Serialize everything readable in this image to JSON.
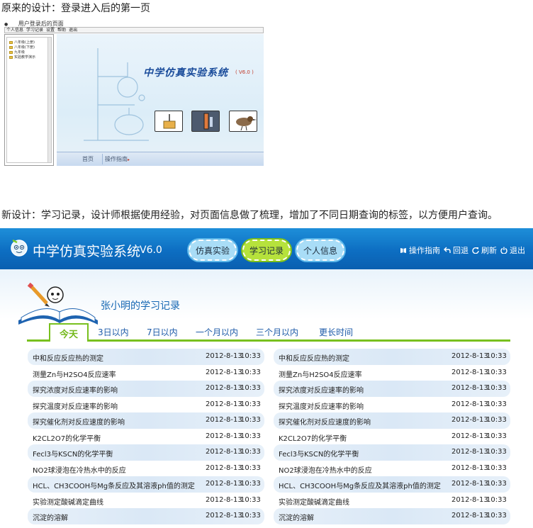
{
  "captions": {
    "old": "原来的设计：登录进入后的第一页",
    "new": "新设计：学习记录，设计师根据使用经验，对页面信息做了梳理，增加了不同日期查询的标签，以方便用户查询。"
  },
  "old_design": {
    "window_title": "用户登录后的页面",
    "menu": [
      "个人信息",
      "学习记录",
      "设置",
      "帮助",
      "退出"
    ],
    "tree_items": [
      "八年级(上册)",
      "八年级(下册)",
      "九年级",
      "实验教学演示"
    ],
    "app_title": "中学仿真实验系统",
    "app_version": "( V6.0 )",
    "nav": {
      "home": "首页",
      "guide": "操作指南",
      "guide_arrow": "▸"
    }
  },
  "new_design": {
    "app_title": "中学仿真实验系统",
    "app_version": "V6.0",
    "nav_pills": {
      "simulation": "仿真实验",
      "records": "学习记录",
      "profile": "个人信息"
    },
    "toolbar": {
      "guide": "操作指南",
      "back": "回退",
      "refresh": "刷新",
      "logout": "退出"
    },
    "page_heading": "张小明的学习记录",
    "tabs": {
      "today": "今天",
      "three_days": "3日以内",
      "seven_days": "7日以内",
      "one_month": "一个月以内",
      "three_months": "三个月以内",
      "longer": "更长时间"
    },
    "records_left": [
      {
        "name": "中和反应反应热的测定",
        "date": "2012-8-13",
        "time": "10:33"
      },
      {
        "name": "测量Zn与H2SO4反应速率",
        "date": "2012-8-13",
        "time": "10:33"
      },
      {
        "name": "探究浓度对反应速率的影响",
        "date": "2012-8-13",
        "time": "10:33"
      },
      {
        "name": "探究温度对反应速率的影响",
        "date": "2012-8-13",
        "time": "10:33"
      },
      {
        "name": "探究催化剂对反应速度的影响",
        "date": "2012-8-13",
        "time": "10:33"
      },
      {
        "name": "K2CL2O7的化学平衡",
        "date": "2012-8-13",
        "time": "10:33"
      },
      {
        "name": "Fecl3与KSCN的化学平衡",
        "date": "2012-8-13",
        "time": "10:33"
      },
      {
        "name": "NO2球浸泡在冷热水中的反应",
        "date": "2012-8-13",
        "time": "10:33"
      },
      {
        "name": "HCL、CH3COOH与Mg条反应及其溶液ph值的测定",
        "date": "2012-8-13",
        "time": "10:33"
      },
      {
        "name": "实验测定酸碱滴定曲线",
        "date": "2012-8-13",
        "time": "10:33"
      },
      {
        "name": "沉淀的溶解",
        "date": "2012-8-13",
        "time": "10:33"
      }
    ],
    "records_right": [
      {
        "name": "中和反应反应热的测定",
        "date": "2012-8-13",
        "time": "10:33"
      },
      {
        "name": "测量Zn与H2SO4反应速率",
        "date": "2012-8-13",
        "time": "10:33"
      },
      {
        "name": "探究浓度对反应速率的影响",
        "date": "2012-8-13",
        "time": "10:33"
      },
      {
        "name": "探究温度对反应速率的影响",
        "date": "2012-8-13",
        "time": "10:33"
      },
      {
        "name": "探究催化剂对反应速度的影响",
        "date": "2012-8-13",
        "time": "10:33"
      },
      {
        "name": "K2CL2O7的化学平衡",
        "date": "2012-8-13",
        "time": "10:33"
      },
      {
        "name": "Fecl3与KSCN的化学平衡",
        "date": "2012-8-13",
        "time": "10:33"
      },
      {
        "name": "NO2球浸泡在冷热水中的反应",
        "date": "2012-8-13",
        "time": "10:33"
      },
      {
        "name": "HCL、CH3COOH与Mg条反应及其溶液ph值的测定",
        "date": "2012-8-13",
        "time": "10:33"
      },
      {
        "name": "实验测定酸碱滴定曲线",
        "date": "2012-8-13",
        "time": "10:33"
      },
      {
        "name": "沉淀的溶解",
        "date": "2012-8-13",
        "time": "10:33"
      }
    ],
    "colors": {
      "header_blue": "#0d6ec2",
      "accent_green": "#78c01e",
      "heading_blue": "#1667b3",
      "row_stripe": "#dae8f6"
    }
  }
}
